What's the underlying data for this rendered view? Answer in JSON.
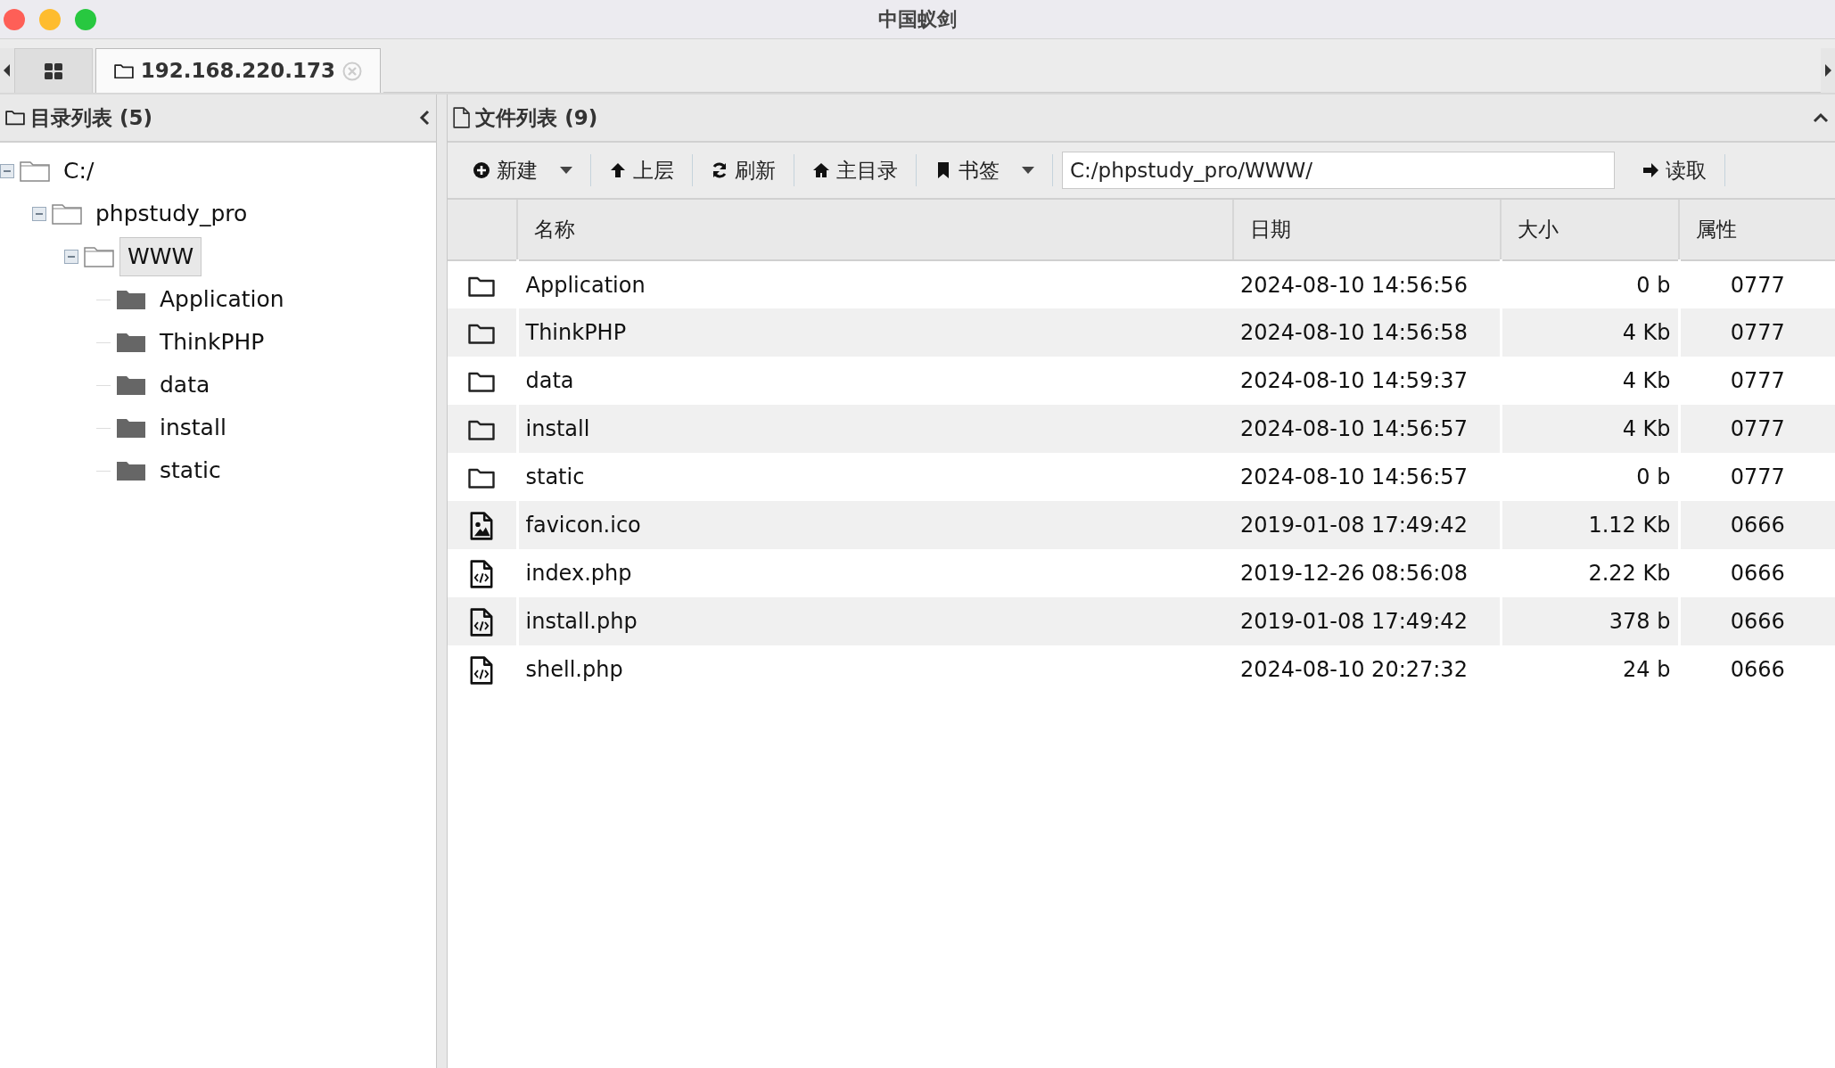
{
  "window": {
    "title": "中国蚁剑"
  },
  "tabs": [
    {
      "kind": "grid",
      "selected": false
    },
    {
      "kind": "folder",
      "label": "192.168.220.173",
      "selected": true
    }
  ],
  "directory_panel": {
    "title": "目录列表 (5)",
    "tree": [
      {
        "label": "C:/",
        "expanded": true,
        "selected": false,
        "children": [
          {
            "label": "phpstudy_pro",
            "expanded": true,
            "selected": false,
            "children": [
              {
                "label": "WWW",
                "expanded": true,
                "selected": true,
                "children": [
                  {
                    "label": "Application",
                    "selected": false
                  },
                  {
                    "label": "ThinkPHP",
                    "selected": false
                  },
                  {
                    "label": "data",
                    "selected": false
                  },
                  {
                    "label": "install",
                    "selected": false
                  },
                  {
                    "label": "static",
                    "selected": false
                  }
                ]
              }
            ]
          }
        ]
      }
    ]
  },
  "file_panel": {
    "title": "文件列表 (9)",
    "toolbar": [
      {
        "label": "新建",
        "dropdown": true
      },
      {
        "label": "上层",
        "dropdown": false
      },
      {
        "label": "刷新",
        "dropdown": false
      },
      {
        "label": "主目录",
        "dropdown": false
      },
      {
        "label": "书签",
        "dropdown": true
      }
    ],
    "path": {
      "value": "C:/phpstudy_pro/WWW/"
    },
    "read_button": {
      "label": "读取"
    },
    "table": {
      "columns": [
        "名称",
        "日期",
        "大小",
        "属性"
      ],
      "rows": [
        {
          "kind": "folder",
          "name": "Application",
          "date": "2024-08-10 14:56:56",
          "size": "0 b",
          "mode": "0777"
        },
        {
          "kind": "folder",
          "name": "ThinkPHP",
          "date": "2024-08-10 14:56:58",
          "size": "4 Kb",
          "mode": "0777"
        },
        {
          "kind": "folder",
          "name": "data",
          "date": "2024-08-10 14:59:37",
          "size": "4 Kb",
          "mode": "0777"
        },
        {
          "kind": "folder",
          "name": "install",
          "date": "2024-08-10 14:56:57",
          "size": "4 Kb",
          "mode": "0777"
        },
        {
          "kind": "folder",
          "name": "static",
          "date": "2024-08-10 14:56:57",
          "size": "0 b",
          "mode": "0777"
        },
        {
          "kind": "image",
          "name": "favicon.ico",
          "date": "2019-01-08 17:49:42",
          "size": "1.12 Kb",
          "mode": "0666"
        },
        {
          "kind": "code",
          "name": "index.php",
          "date": "2019-12-26 08:56:08",
          "size": "2.22 Kb",
          "mode": "0666"
        },
        {
          "kind": "code",
          "name": "install.php",
          "date": "2019-01-08 17:49:42",
          "size": "378 b",
          "mode": "0666"
        },
        {
          "kind": "code",
          "name": "shell.php",
          "date": "2024-08-10 20:27:32",
          "size": "24 b",
          "mode": "0666"
        }
      ]
    }
  }
}
